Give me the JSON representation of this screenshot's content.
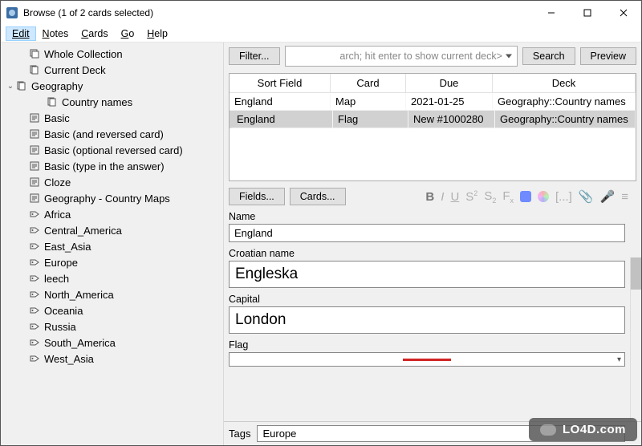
{
  "window": {
    "title": "Browse (1 of 2 cards selected)"
  },
  "menu": {
    "edit": "Edit",
    "notes": "Notes",
    "cards": "Cards",
    "go": "Go",
    "help": "Help"
  },
  "sidebar": {
    "items": [
      {
        "label": "Whole Collection",
        "icon": "stack"
      },
      {
        "label": "Current Deck",
        "icon": "deck"
      },
      {
        "label": "Geography",
        "icon": "deck",
        "caret": "▾"
      },
      {
        "label": "Country names",
        "icon": "deck"
      },
      {
        "label": "Basic",
        "icon": "note"
      },
      {
        "label": "Basic (and reversed card)",
        "icon": "note"
      },
      {
        "label": "Basic (optional reversed card)",
        "icon": "note"
      },
      {
        "label": "Basic (type in the answer)",
        "icon": "note"
      },
      {
        "label": "Cloze",
        "icon": "note"
      },
      {
        "label": "Geography - Country Maps",
        "icon": "note"
      },
      {
        "label": "Africa",
        "icon": "tag"
      },
      {
        "label": "Central_America",
        "icon": "tag"
      },
      {
        "label": "East_Asia",
        "icon": "tag"
      },
      {
        "label": "Europe",
        "icon": "tag"
      },
      {
        "label": "leech",
        "icon": "tag"
      },
      {
        "label": "North_America",
        "icon": "tag"
      },
      {
        "label": "Oceania",
        "icon": "tag"
      },
      {
        "label": "Russia",
        "icon": "tag"
      },
      {
        "label": "South_America",
        "icon": "tag"
      },
      {
        "label": "West_Asia",
        "icon": "tag"
      }
    ]
  },
  "toolbar": {
    "filter": "Filter...",
    "search_text": "arch; hit enter to show current deck>",
    "search": "Search",
    "preview": "Preview"
  },
  "table": {
    "headers": [
      "Sort Field",
      "Card",
      "Due",
      "Deck"
    ],
    "rows": [
      {
        "cells": [
          "England",
          "Map",
          "2021-01-25",
          "Geography::Country names"
        ],
        "selected": false
      },
      {
        "cells": [
          "England",
          "Flag",
          "New #1000280",
          "Geography::Country names"
        ],
        "selected": true
      }
    ]
  },
  "editor": {
    "fields_btn": "Fields...",
    "cards_btn": "Cards...",
    "fields": [
      {
        "label": "Name",
        "value": "England",
        "size": "small"
      },
      {
        "label": "Croatian name",
        "value": "Engleska",
        "size": "large"
      },
      {
        "label": "Capital",
        "value": "London",
        "size": "large"
      },
      {
        "label": "Flag",
        "value": "",
        "size": "flag"
      }
    ],
    "tags_label": "Tags",
    "tags_value": "Europe"
  },
  "watermark": "LO4D.com"
}
